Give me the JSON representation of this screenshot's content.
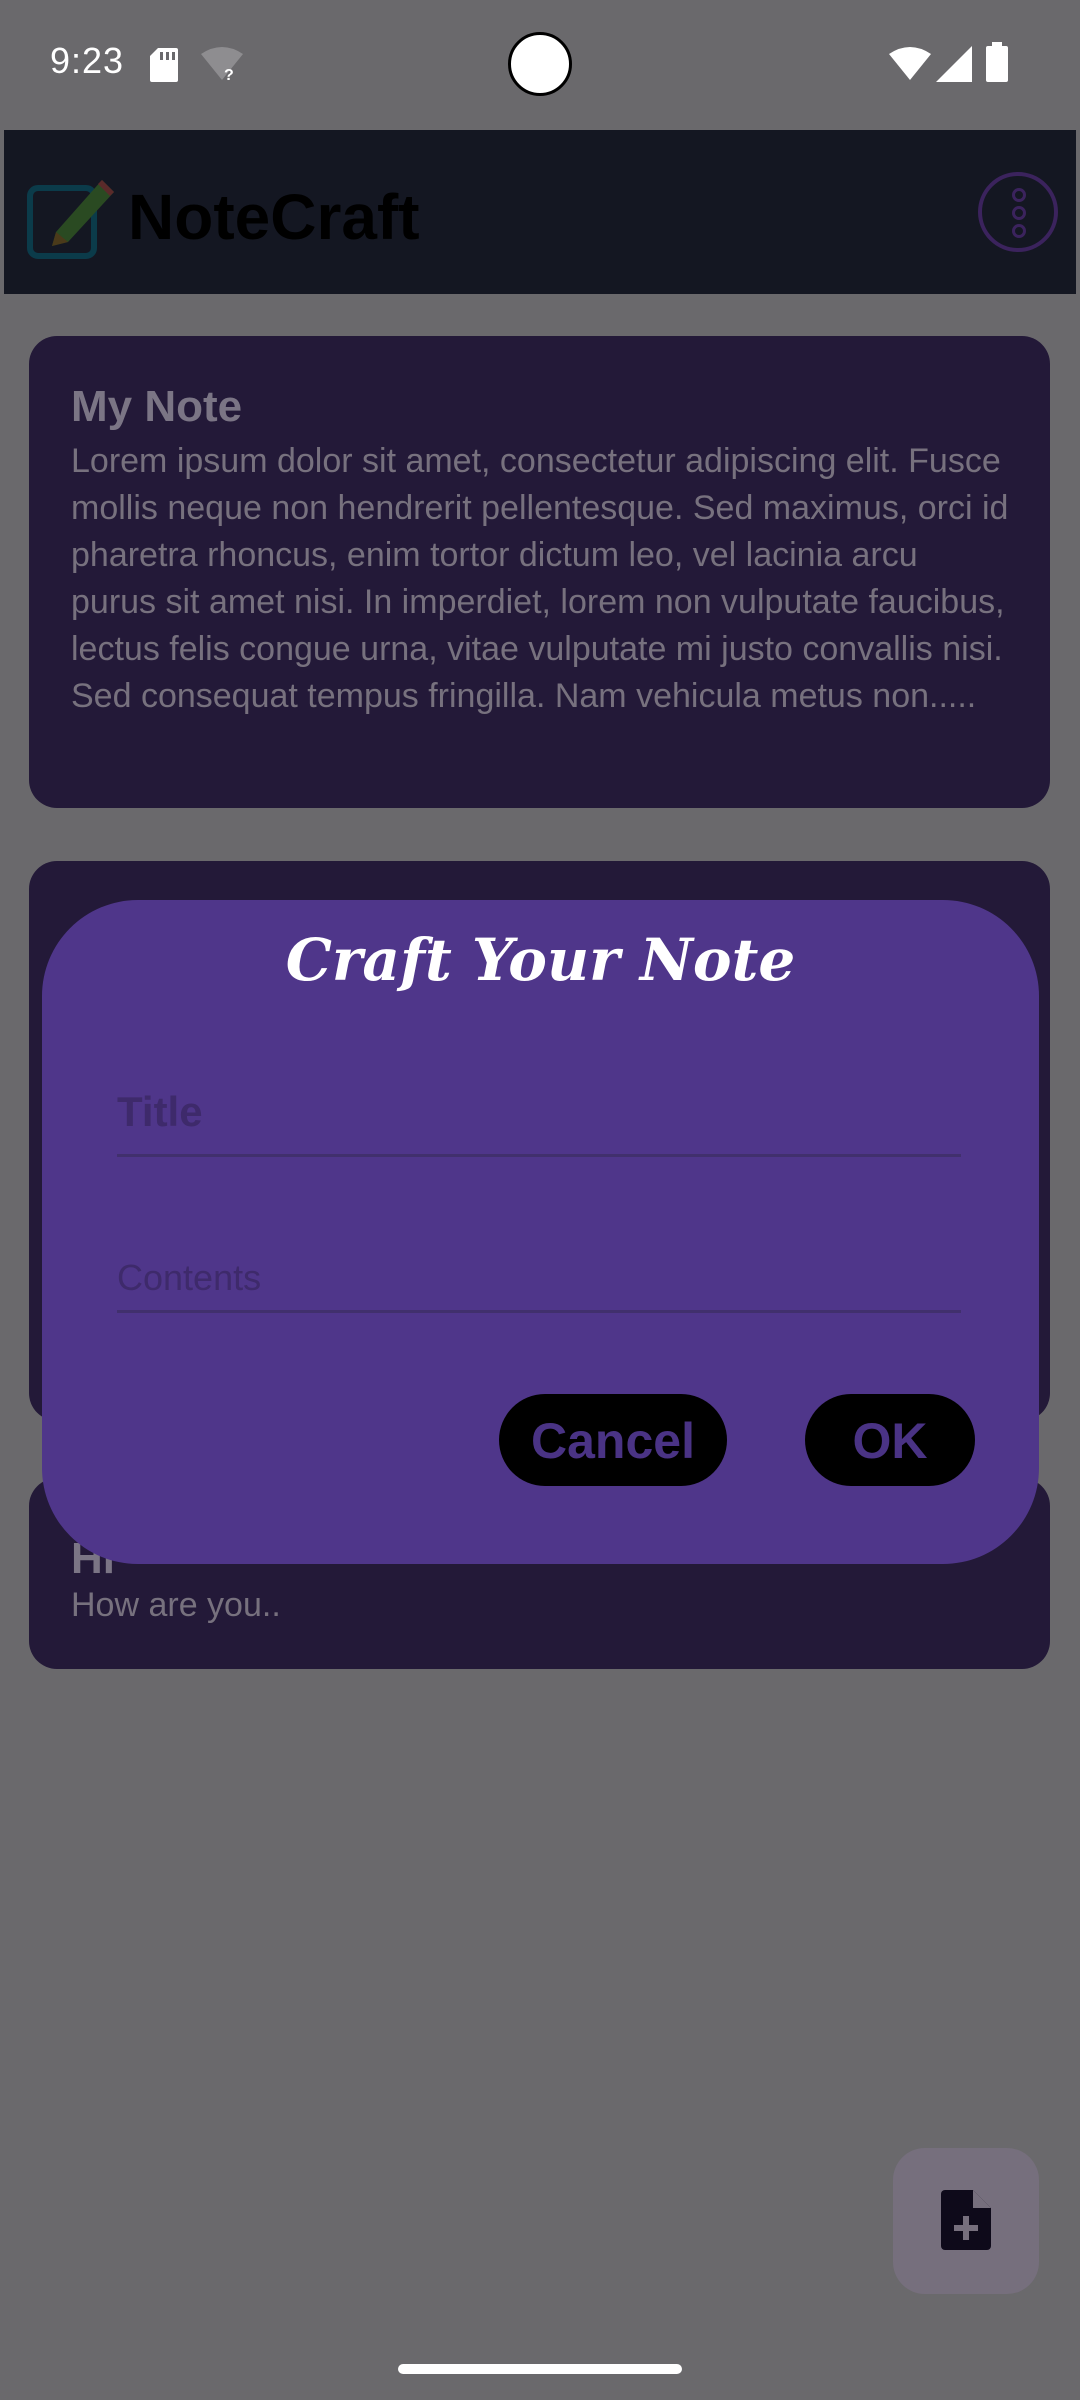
{
  "status_bar": {
    "time": "9:23",
    "icons": [
      "sd-card-icon",
      "wifi-unknown-icon",
      "wifi-icon",
      "signal-icon",
      "battery-icon"
    ]
  },
  "app_bar": {
    "title": "NoteCraft",
    "logo_icon": "edit-note-icon",
    "menu_icon": "more-vert-icon"
  },
  "notes": [
    {
      "title": "My Note",
      "body": "Lorem ipsum dolor sit amet, consectetur adipiscing elit. Fusce mollis neque non hendrerit pellentesque. Sed maximus, orci id pharetra rhoncus, enim tortor dictum leo, vel lacinia arcu purus sit amet nisi. In imperdiet, lorem non vulputate faucibus, lectus felis congue urna, vitae vulputate mi justo convallis nisi. Sed consequat tempus fringilla. Nam vehicula metus non....."
    },
    {
      "title": "",
      "body": ""
    },
    {
      "title": "Hi",
      "body": "How are you.."
    }
  ],
  "dialog": {
    "title": "Craft Your Note",
    "title_placeholder": "Title",
    "contents_placeholder": "Contents",
    "cancel_label": "Cancel",
    "ok_label": "OK"
  },
  "fab": {
    "icon": "note-add-icon"
  },
  "colors": {
    "scrim": "#6a696c",
    "card": "#231938",
    "dialog": "#4f368a",
    "button": "#000000",
    "button_text": "#4a3385"
  }
}
